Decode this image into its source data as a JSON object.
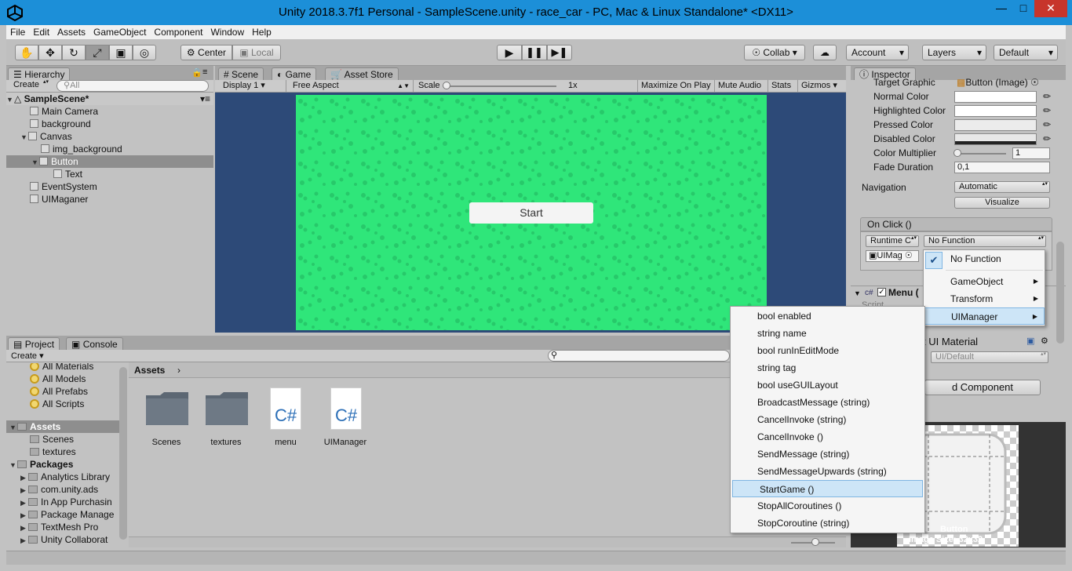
{
  "window": {
    "title": "Unity 2018.3.7f1 Personal - SampleScene.unity - race_car - PC, Mac & Linux Standalone* <DX11>",
    "minimize_icon": "minimize-icon",
    "maximize_icon": "maximize-icon",
    "close_icon": "close-icon"
  },
  "menu": [
    "File",
    "Edit",
    "Assets",
    "GameObject",
    "Component",
    "Window",
    "Help"
  ],
  "toolbar": {
    "center": "Center",
    "local": "Local",
    "collab": "Collab",
    "account": "Account",
    "layers": "Layers",
    "layout": "Default"
  },
  "hierarchy": {
    "tab": "Hierarchy",
    "create": "Create",
    "search_placeholder": "All",
    "scene": "SampleScene*",
    "items": [
      "Main Camera",
      "background",
      "Canvas",
      "img_background",
      "Button",
      "Text",
      "EventSystem",
      "UIMaganer"
    ]
  },
  "scene_tabs": [
    "Scene",
    "Game",
    "Asset Store"
  ],
  "game": {
    "display": "Display 1",
    "aspect": "Free Aspect",
    "scale_label": "Scale",
    "scale_value": "1x",
    "maximize": "Maximize On Play",
    "mute": "Mute Audio",
    "stats": "Stats",
    "gizmos": "Gizmos",
    "start_button": "Start"
  },
  "inspector": {
    "tab": "Inspector",
    "target_graphic_label": "Target Graphic",
    "target_graphic_value": "Button (Image)",
    "normal_color": "Normal Color",
    "highlighted_color": "Highlighted Color",
    "pressed_color": "Pressed Color",
    "disabled_color": "Disabled Color",
    "color_multiplier": "Color Multiplier",
    "color_multiplier_value": "1",
    "fade_duration": "Fade Duration",
    "fade_duration_value": "0,1",
    "navigation": "Navigation",
    "navigation_value": "Automatic",
    "visualize": "Visualize",
    "onclick": "On Click ()",
    "runtime": "Runtime C",
    "function": "No Function",
    "object_field": "UIMag",
    "menu_component": "Menu (",
    "script_label": "Script",
    "ui_material": "t UI Material",
    "ui_default": "UI/Default",
    "add_component": "d Component",
    "preview_name": "Button",
    "image_size": "Image Size: 32x32"
  },
  "project": {
    "tabs": [
      "Project",
      "Console"
    ],
    "create": "Create",
    "favorites": [
      "All Materials",
      "All Models",
      "All Prefabs",
      "All Scripts"
    ],
    "assets_header": "Assets",
    "asset_folders": [
      "Scenes",
      "textures"
    ],
    "packages_header": "Packages",
    "packages": [
      "Analytics Library",
      "com.unity.ads",
      "In App Purchasin",
      "Package Manage",
      "TextMesh Pro",
      "Unity Collaborat"
    ],
    "breadcrumb": "Assets",
    "items": [
      {
        "name": "Scenes",
        "type": "folder"
      },
      {
        "name": "textures",
        "type": "folder"
      },
      {
        "name": "menu",
        "type": "script"
      },
      {
        "name": "UIManager",
        "type": "script"
      }
    ]
  },
  "context_menu_1": {
    "checked": "No Function",
    "items": [
      "GameObject",
      "Transform",
      "UIManager"
    ],
    "highlighted": "UIManager"
  },
  "context_menu_2": {
    "items": [
      "bool enabled",
      "string name",
      "bool runInEditMode",
      "string tag",
      "bool useGUILayout",
      "BroadcastMessage (string)",
      "CancelInvoke (string)",
      "CancelInvoke ()",
      "SendMessage (string)",
      "SendMessageUpwards (string)",
      "StartGame ()",
      "StopAllCoroutines ()",
      "StopCoroutine (string)"
    ],
    "highlighted": "StartGame ()"
  },
  "colors": {
    "titlebar": "#1c8fd8",
    "game_bg": "#2d4a78",
    "game_green": "#2fe67a",
    "selection": "#8e8e8e",
    "close_btn": "#c7352b"
  }
}
